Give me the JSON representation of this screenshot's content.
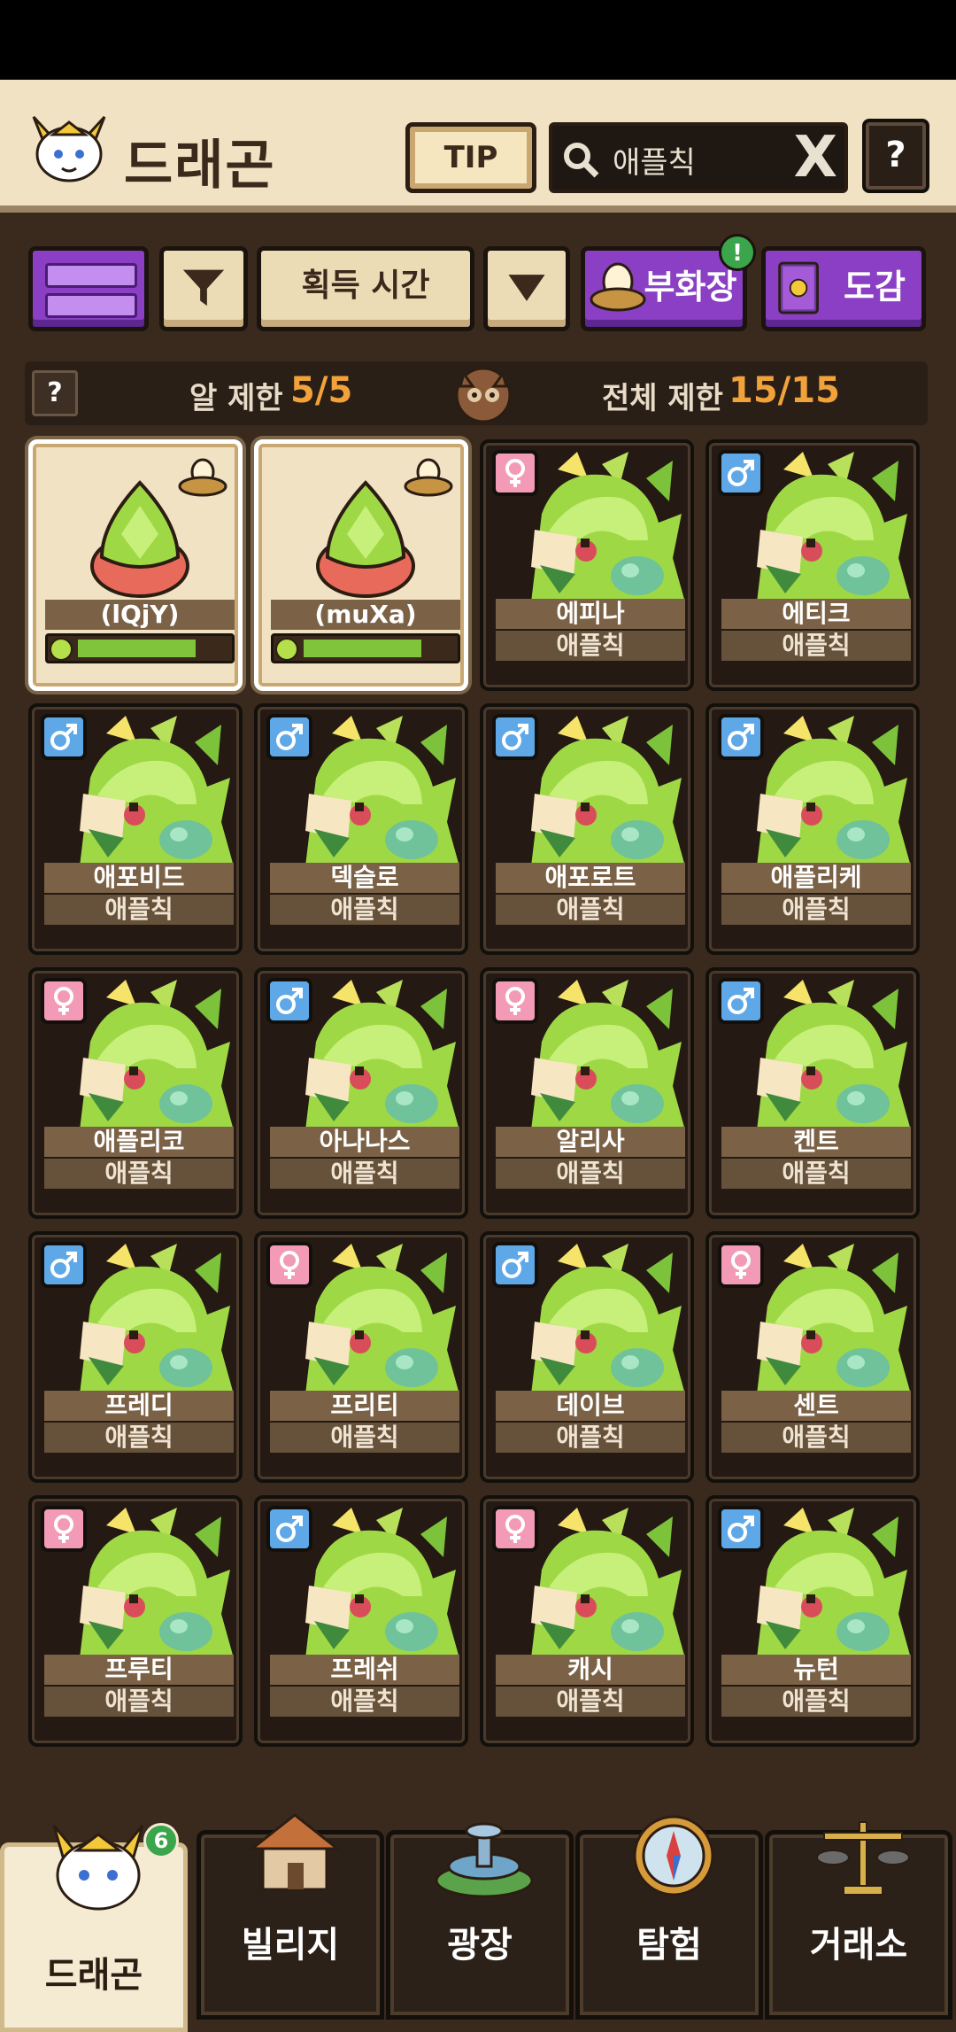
{
  "header": {
    "title": "드래곤",
    "tip_label": "TIP",
    "search_value": "애플칙",
    "search_clear": "X",
    "help": "?"
  },
  "toolbar": {
    "sort_label": "획득 시간",
    "incubator_label": "부화장",
    "dex_label": "도감",
    "notice": "!"
  },
  "limits": {
    "help": "?",
    "egg_label": "알 제한",
    "egg_value": "5/5",
    "total_label": "전체 제한",
    "total_value": "15/15"
  },
  "eggs": [
    {
      "name": "(lQjY)",
      "progress": 0.78
    },
    {
      "name": "(muXa)",
      "progress": 0.78
    }
  ],
  "dragons": [
    {
      "name": "에피나",
      "species": "애플칙",
      "gender": "female"
    },
    {
      "name": "에티크",
      "species": "애플칙",
      "gender": "male"
    },
    {
      "name": "애포비드",
      "species": "애플칙",
      "gender": "male"
    },
    {
      "name": "덱슬로",
      "species": "애플칙",
      "gender": "male"
    },
    {
      "name": "애포로트",
      "species": "애플칙",
      "gender": "male"
    },
    {
      "name": "애플리케",
      "species": "애플칙",
      "gender": "male"
    },
    {
      "name": "애플리코",
      "species": "애플칙",
      "gender": "female"
    },
    {
      "name": "아나나스",
      "species": "애플칙",
      "gender": "male"
    },
    {
      "name": "알리사",
      "species": "애플칙",
      "gender": "female"
    },
    {
      "name": "켄트",
      "species": "애플칙",
      "gender": "male"
    },
    {
      "name": "프레디",
      "species": "애플칙",
      "gender": "male"
    },
    {
      "name": "프리티",
      "species": "애플칙",
      "gender": "female"
    },
    {
      "name": "데이브",
      "species": "애플칙",
      "gender": "male"
    },
    {
      "name": "센트",
      "species": "애플칙",
      "gender": "female"
    },
    {
      "name": "프루티",
      "species": "애플칙",
      "gender": "female"
    },
    {
      "name": "프레쉬",
      "species": "애플칙",
      "gender": "male"
    },
    {
      "name": "캐시",
      "species": "애플칙",
      "gender": "female"
    },
    {
      "name": "뉴턴",
      "species": "애플칙",
      "gender": "male"
    }
  ],
  "nav": {
    "tabs": [
      {
        "label": "드래곤",
        "icon": "dragon-icon",
        "active": true,
        "badge": "6"
      },
      {
        "label": "빌리지",
        "icon": "village-icon"
      },
      {
        "label": "광장",
        "icon": "fountain-icon"
      },
      {
        "label": "탐험",
        "icon": "compass-icon"
      },
      {
        "label": "거래소",
        "icon": "scale-icon"
      }
    ]
  },
  "colors": {
    "background": "#3a2a1d",
    "header": "#f0e2c2",
    "accent_purple": "#8a3fc4",
    "limit_value": "#f2a23a",
    "male": "#5fa8e8",
    "female": "#f29ab6"
  }
}
